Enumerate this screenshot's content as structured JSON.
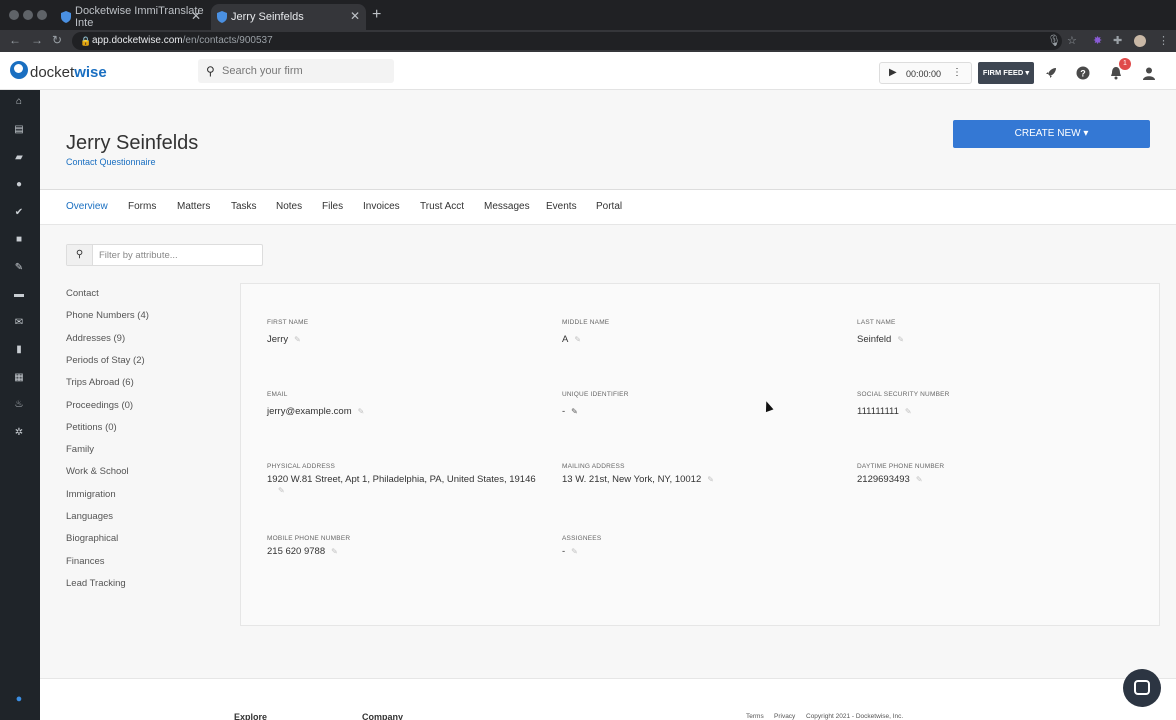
{
  "browser": {
    "tabs": [
      {
        "title": "Docketwise ImmiTranslate Inte",
        "active": false
      },
      {
        "title": "Jerry Seinfelds",
        "active": true
      }
    ],
    "url_host": "app.docketwise.com",
    "url_path": "/en/contacts/900537"
  },
  "header": {
    "logo_prefix": "docket",
    "logo_suffix": "wise",
    "search_placeholder": "Search your firm",
    "timer": "00:00:00",
    "firm_feed_label": "FIRM FEED",
    "notification_count": "1"
  },
  "contact": {
    "name": "Jerry Seinfelds",
    "subtitle": "Contact Questionnaire",
    "create_button": "CREATE NEW"
  },
  "tabs": [
    "Overview",
    "Forms",
    "Matters",
    "Tasks",
    "Notes",
    "Files",
    "Invoices",
    "Trust Acct",
    "Messages",
    "Events",
    "Portal"
  ],
  "active_tab": "Overview",
  "filter_placeholder": "Filter by attribute...",
  "categories": [
    "Contact",
    "Phone Numbers (4)",
    "Addresses (9)",
    "Periods of Stay (2)",
    "Trips Abroad (6)",
    "Proceedings (0)",
    "Petitions (0)",
    "Family",
    "Work & School",
    "Immigration",
    "Languages",
    "Biographical",
    "Finances",
    "Lead Tracking"
  ],
  "fields": {
    "first_name": {
      "label": "First Name",
      "value": "Jerry"
    },
    "middle_name": {
      "label": "Middle Name",
      "value": "A"
    },
    "last_name": {
      "label": "Last Name",
      "value": "Seinfeld"
    },
    "email": {
      "label": "Email",
      "value": "jerry@example.com"
    },
    "unique_identifier": {
      "label": "Unique Identifier",
      "value": "-"
    },
    "ssn": {
      "label": "Social Security Number",
      "value": "111111111"
    },
    "physical_address": {
      "label": "Physical Address",
      "value": "1920 W.81 Street, Apt 1, Philadelphia, PA, United States, 19146"
    },
    "mailing_address": {
      "label": "Mailing Address",
      "value": "13 W. 21st, New York, NY, 10012"
    },
    "daytime_phone": {
      "label": "Daytime Phone Number",
      "value": "2129693493"
    },
    "mobile_phone": {
      "label": "Mobile Phone Number",
      "value": "215 620 9788"
    },
    "assignees": {
      "label": "Assignees",
      "value": "-"
    }
  },
  "footer": {
    "explore": "Explore",
    "company": "Company",
    "terms": "Terms",
    "privacy": "Privacy",
    "copyright": "Copyright 2021 - Docketwise, Inc."
  },
  "colors": {
    "accent": "#1a6fc1",
    "create_button": "#3478d4",
    "sidebar": "#1f2429",
    "firm_feed": "#3e4652",
    "badge": "#e04b4b"
  }
}
